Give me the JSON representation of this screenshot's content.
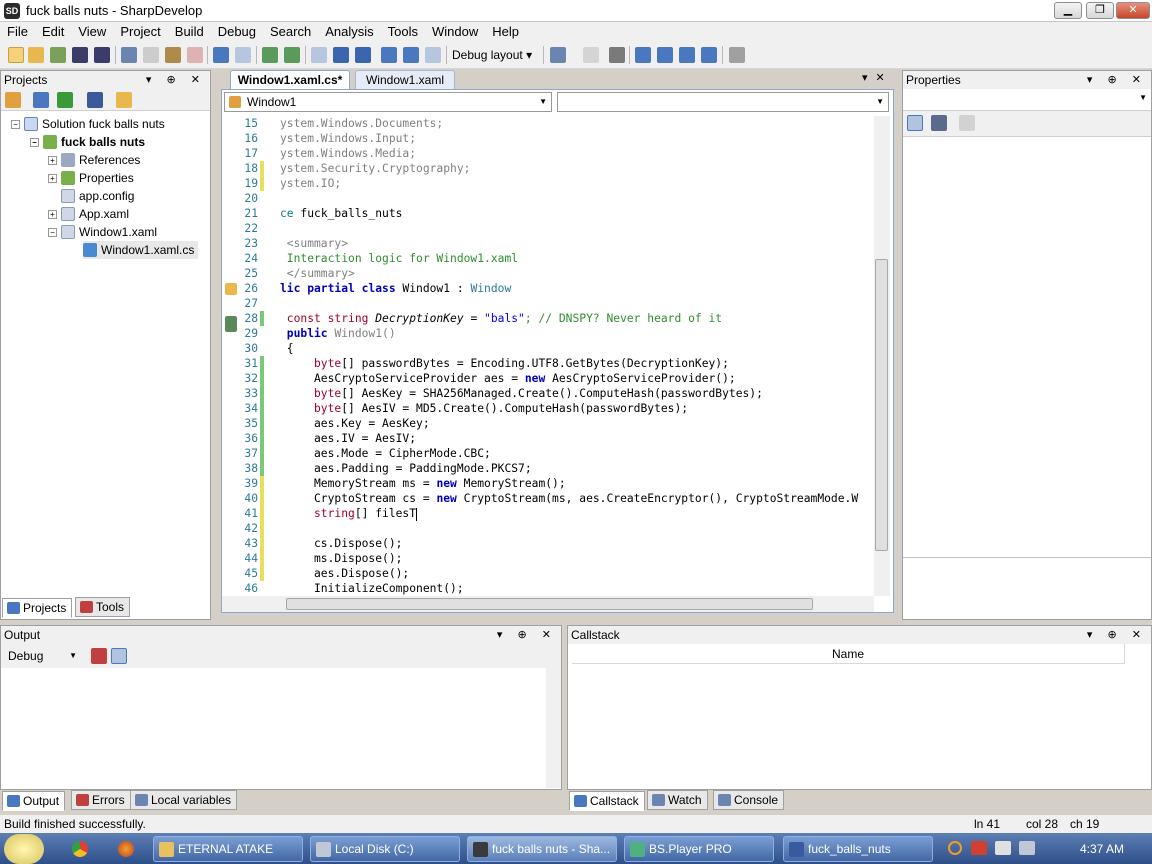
{
  "window": {
    "title": "fuck balls nuts - SharpDevelop",
    "min": "▁",
    "max": "❐",
    "close": "✕"
  },
  "menu": [
    "File",
    "Edit",
    "View",
    "Project",
    "Build",
    "Debug",
    "Search",
    "Analysis",
    "Tools",
    "Window",
    "Help"
  ],
  "toolbar": {
    "layout_label": "Debug layout",
    "dropdown_arrow": "▾"
  },
  "projects": {
    "title": "Projects",
    "tree": [
      {
        "label": "Solution fuck balls nuts"
      },
      {
        "label": "fuck balls nuts"
      },
      {
        "label": "References"
      },
      {
        "label": "Properties"
      },
      {
        "label": "app.config"
      },
      {
        "label": "App.xaml"
      },
      {
        "label": "Window1.xaml"
      },
      {
        "label": "Window1.xaml.cs"
      }
    ],
    "tabs": [
      "Projects",
      "Tools"
    ]
  },
  "editor": {
    "tabs": [
      "Window1.xaml.cs*",
      "Window1.xaml"
    ],
    "class_combo": "Window1",
    "member_combo": ""
  },
  "code_lines": [
    {
      "n": "15",
      "t": "ystem.Windows.Documents;"
    },
    {
      "n": "16",
      "t": "ystem.Windows.Input;"
    },
    {
      "n": "17",
      "t": "ystem.Windows.Media;"
    },
    {
      "n": "18",
      "t": "ystem.Security.Cryptography;"
    },
    {
      "n": "19",
      "t": "ystem.IO;"
    },
    {
      "n": "20",
      "t": ""
    },
    {
      "n": "21",
      "a": "ce",
      "b": " fuck_balls_nuts"
    },
    {
      "n": "22",
      "t": ""
    },
    {
      "n": "23",
      "t": " <summary>"
    },
    {
      "n": "24",
      "t": " Interaction logic for Window1.xaml"
    },
    {
      "n": "25",
      "t": " </summary>"
    },
    {
      "n": "26",
      "a": "lic partial class",
      "b": " Window1 : ",
      "c": "Window"
    },
    {
      "n": "27",
      "t": ""
    },
    {
      "n": "28",
      "a": " const string",
      "b": " DecryptionKey",
      "c": " = ",
      "d": "\"bals\"",
      "e": "; // DNSPY? Never heard of it"
    },
    {
      "n": "29",
      "a": " public",
      "b": " Window1()"
    },
    {
      "n": "30",
      "t": " {"
    },
    {
      "n": "31",
      "a": "     byte",
      "b": "[] passwordBytes = Encoding.UTF8.GetBytes(DecryptionKey);"
    },
    {
      "n": "32",
      "a": "     AesCryptoServiceProvider aes = ",
      "b": "new",
      "c": " AesCryptoServiceProvider();"
    },
    {
      "n": "33",
      "a": "     byte",
      "b": "[] AesKey = SHA256Managed.Create().ComputeHash(passwordBytes);"
    },
    {
      "n": "34",
      "a": "     byte",
      "b": "[] AesIV = MD5.Create().ComputeHash(passwordBytes);"
    },
    {
      "n": "35",
      "t": "     aes.Key = AesKey;"
    },
    {
      "n": "36",
      "t": "     aes.IV = AesIV;"
    },
    {
      "n": "37",
      "t": "     aes.Mode = CipherMode.CBC;"
    },
    {
      "n": "38",
      "t": "     aes.Padding = PaddingMode.PKCS7;"
    },
    {
      "n": "39",
      "a": "     MemoryStream ms = ",
      "b": "new",
      "c": " MemoryStream();"
    },
    {
      "n": "40",
      "a": "     CryptoStream cs = ",
      "b": "new",
      "c": " CryptoStream(ms, aes.CreateEncryptor(), CryptoStreamMode.W"
    },
    {
      "n": "41",
      "a": "     string",
      "b": "[] filesT"
    },
    {
      "n": "42",
      "t": ""
    },
    {
      "n": "43",
      "t": "     cs.Dispose();"
    },
    {
      "n": "44",
      "t": "     ms.Dispose();"
    },
    {
      "n": "45",
      "t": "     aes.Dispose();"
    },
    {
      "n": "46",
      "t": "     InitializeComponent();"
    }
  ],
  "properties": {
    "title": "Properties"
  },
  "output": {
    "title": "Output",
    "source": "Debug",
    "tabs": [
      "Output",
      "Errors",
      "Local variables"
    ]
  },
  "callstack": {
    "title": "Callstack",
    "column": "Name",
    "tabs": [
      "Callstack",
      "Watch",
      "Console"
    ]
  },
  "status": {
    "message": "Build finished successfully.",
    "line": "ln 41",
    "col": "col 28",
    "ch": "ch 19"
  },
  "taskbar": {
    "items": [
      "ETERNAL ATAKE",
      "Local Disk (C:)",
      "fuck balls nuts - Sha...",
      "BS.Player PRO",
      "fuck_balls_nuts"
    ],
    "clock": "4:37 AM"
  }
}
